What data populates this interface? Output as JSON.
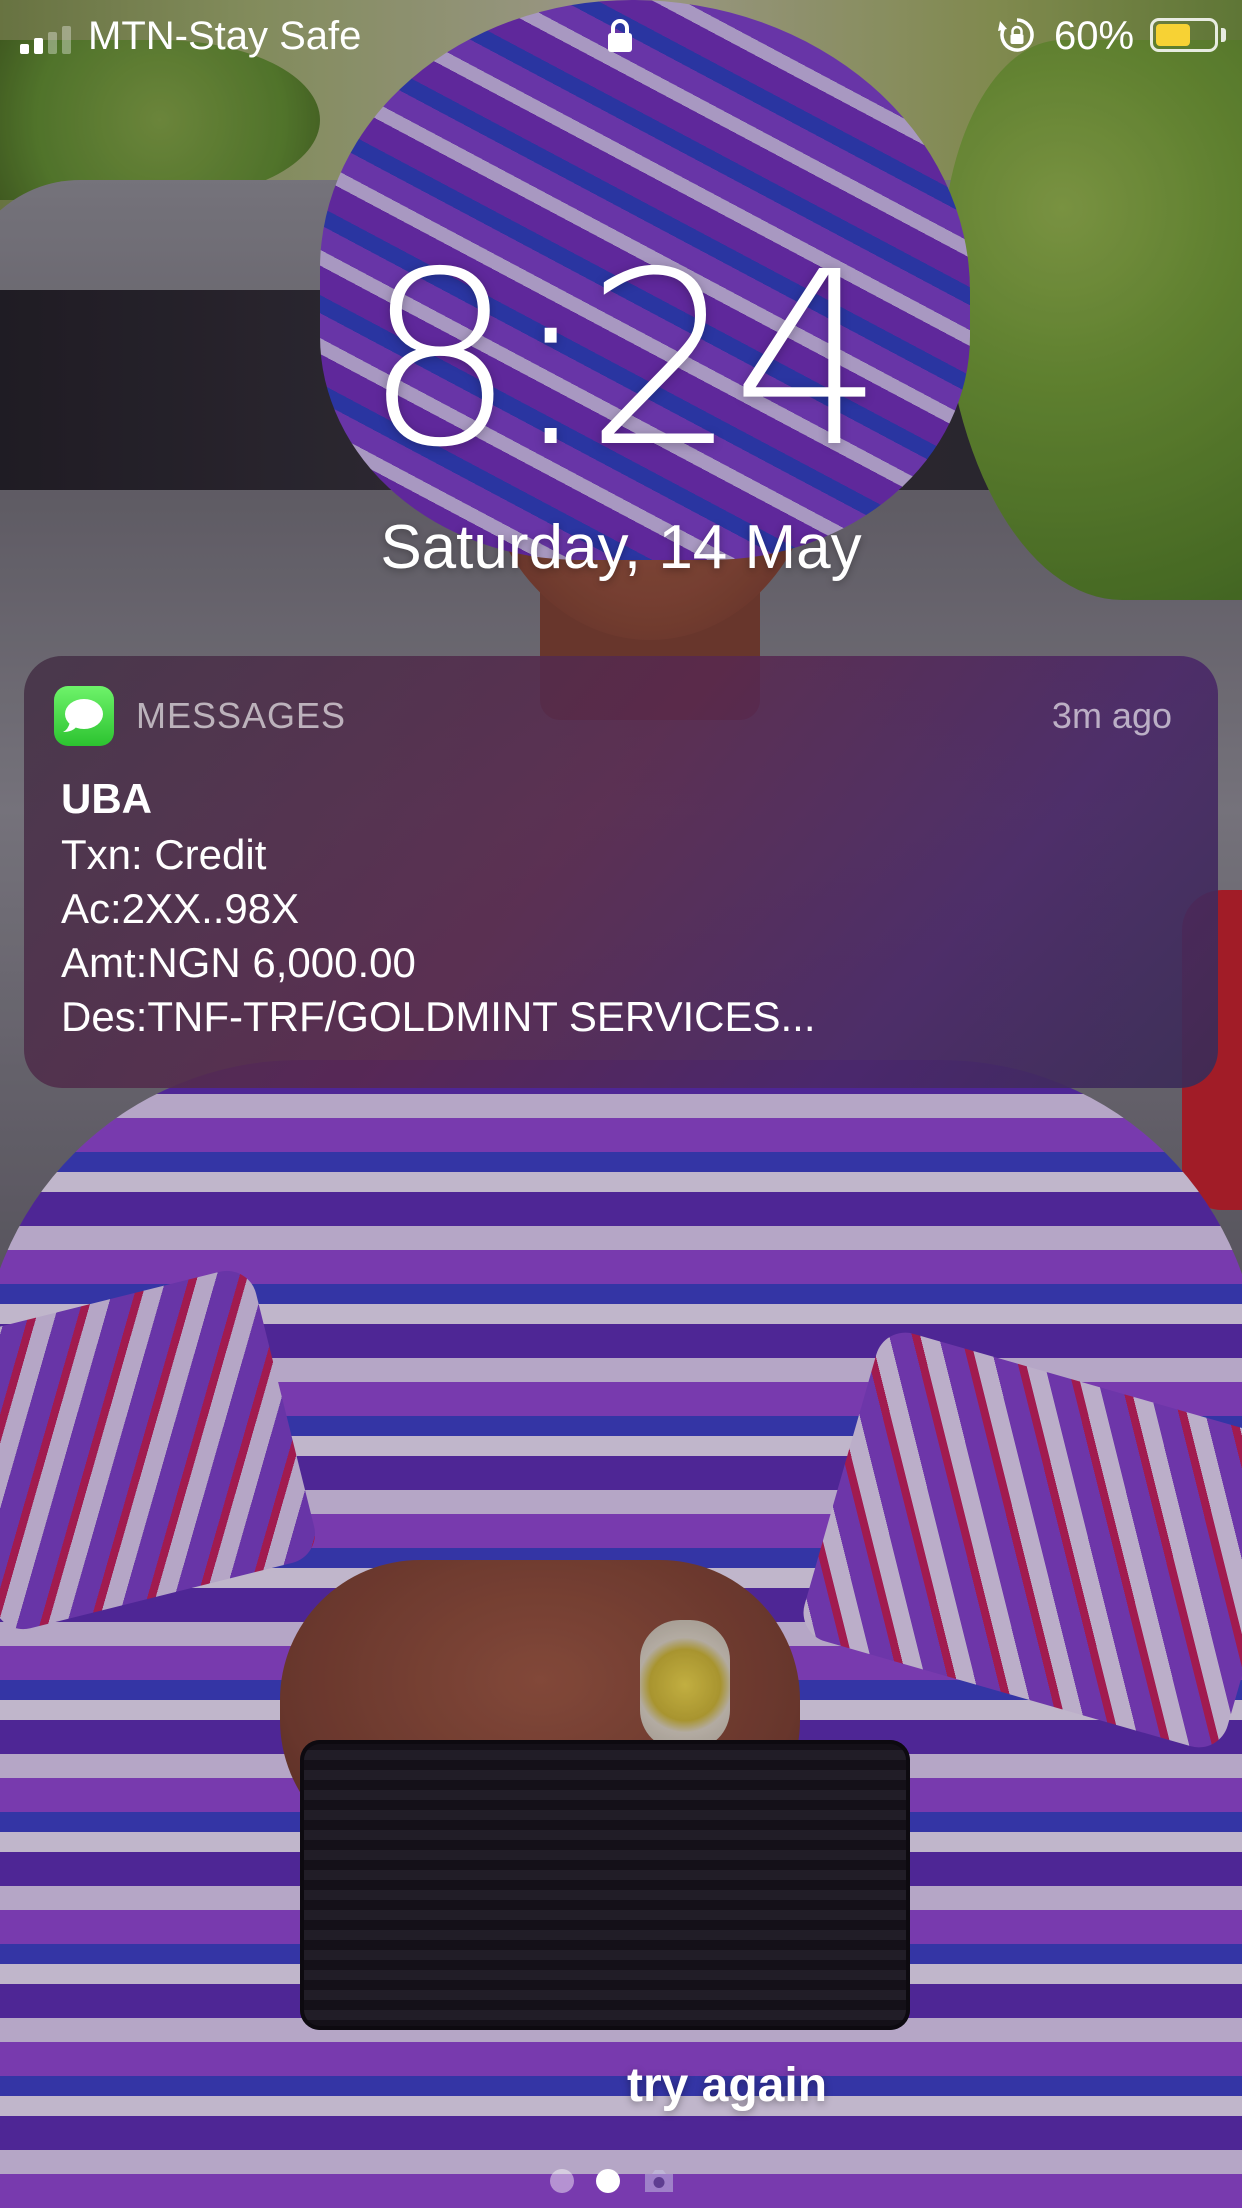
{
  "status_bar": {
    "carrier": "MTN-Stay Safe",
    "signal_bars_active": 2,
    "signal_bars_total": 4,
    "battery_percent_label": "60%",
    "battery_level": 0.6,
    "battery_color": "#f7d234",
    "lock_icon": "lock-icon",
    "rotation_lock_icon": "rotation-lock-icon"
  },
  "clock": {
    "time": "8:24",
    "date": "Saturday, 14 May"
  },
  "notification": {
    "app_icon": "messages-app-icon",
    "app_name": "MESSAGES",
    "time_ago": "3m ago",
    "sender": "UBA",
    "lines": [
      "Txn: Credit",
      "Ac:2XX..98X",
      "Amt:NGN 6,000.00",
      "Des:TNF-TRF/GOLDMINT SERVICES..."
    ]
  },
  "bottom": {
    "hint": "try again",
    "pages": {
      "count": 2,
      "active": 2
    },
    "camera_icon": "camera-icon"
  }
}
